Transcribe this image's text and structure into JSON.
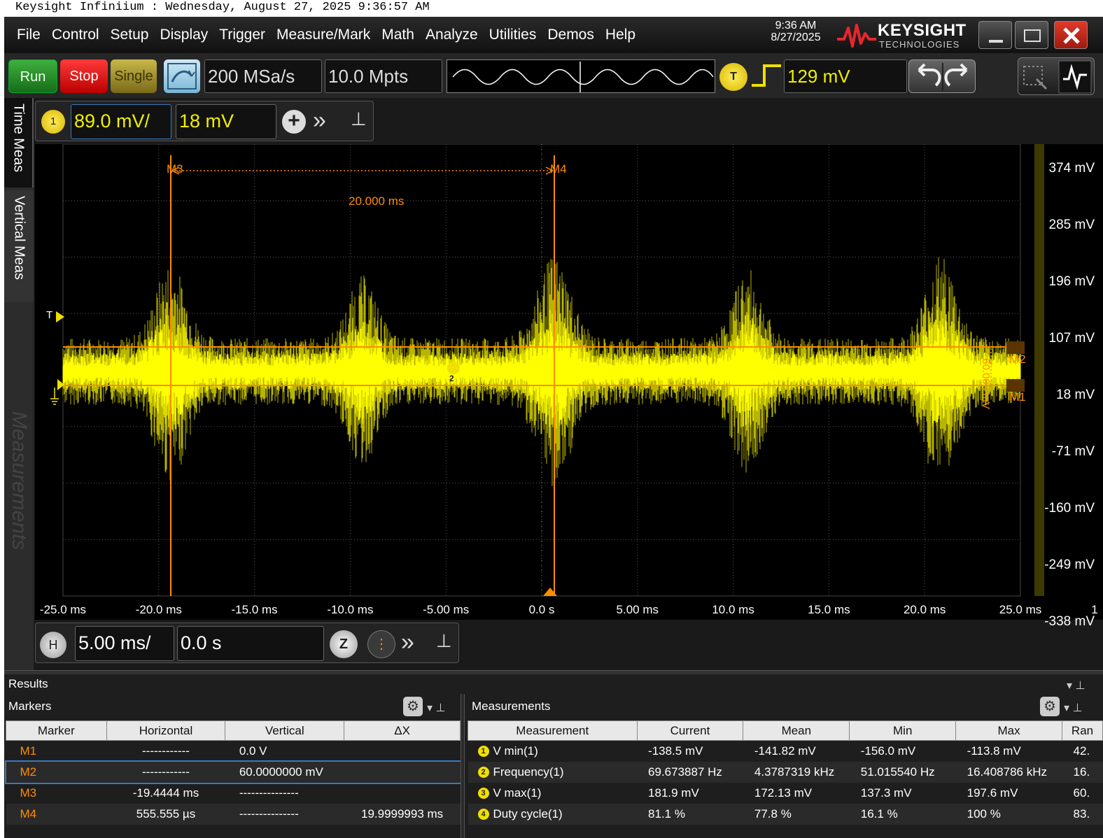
{
  "caption": "Keysight Infiniium : Wednesday, August 27, 2025 9:36:57 AM",
  "menu": [
    "File",
    "Control",
    "Setup",
    "Display",
    "Trigger",
    "Measure/Mark",
    "Math",
    "Analyze",
    "Utilities",
    "Demos",
    "Help"
  ],
  "clock": {
    "time": "9:36 AM",
    "date": "8/27/2025"
  },
  "brand": {
    "name": "KEYSIGHT",
    "sub": "TECHNOLOGIES"
  },
  "toolbar": {
    "run": "Run",
    "stop": "Stop",
    "single": "Single",
    "sample_rate": "200 MSa/s",
    "memory_depth": "10.0 Mpts",
    "trigger_badge": "T",
    "trigger_level": "129 mV"
  },
  "side_tabs": {
    "time_meas": "Time Meas",
    "vertical_meas": "Vertical Meas",
    "measurements": "Measurements"
  },
  "channel": {
    "badge": "1",
    "scale": "89.0 mV/",
    "offset": "18 mV"
  },
  "horizontal": {
    "badge": "H",
    "scale": "5.00 ms/",
    "position": "0.0 s",
    "zoom": "Z"
  },
  "scope": {
    "y_labels": [
      "374 mV",
      "285 mV",
      "196 mV",
      "107 mV",
      "18 mV",
      "-71 mV",
      "-160 mV",
      "-249 mV",
      "-338 mV"
    ],
    "x_labels": [
      "-25.0 ms",
      "-20.0 ms",
      "-15.0 ms",
      "-10.0 ms",
      "-5.00 ms",
      "0.0 s",
      "5.00 ms",
      "10.0 ms",
      "15.0 ms",
      "20.0 ms",
      "25.0 ms"
    ],
    "x_extra": "1",
    "markers": {
      "m1": "M1",
      "m2": "M2",
      "m3": "M3",
      "m4": "M4"
    },
    "delta_x": "20.000 ms",
    "delta_y": "60.000 mV",
    "trigger_marker": "T",
    "meas_marker": "2",
    "colors": {
      "trace": "#ffff00",
      "marker": "#ff8c00",
      "grid": "#555555"
    }
  },
  "results": {
    "title": "Results",
    "markers_title": "Markers",
    "measurements_title": "Measurements",
    "marker_headers": [
      "Marker",
      "Horizontal",
      "Vertical",
      "ΔX"
    ],
    "marker_rows": [
      {
        "name": "M1",
        "horizontal": "------------",
        "vertical": "0.0 V",
        "dx": ""
      },
      {
        "name": "M2",
        "horizontal": "------------",
        "vertical": "60.0000000 mV",
        "dx": ""
      },
      {
        "name": "M3",
        "horizontal": "-19.4444 ms",
        "vertical": "---------------",
        "dx": ""
      },
      {
        "name": "M4",
        "horizontal": "555.555 µs",
        "vertical": "---------------",
        "dx": "19.9999993 ms"
      }
    ],
    "meas_headers": [
      "Measurement",
      "Current",
      "Mean",
      "Min",
      "Max",
      "Ran"
    ],
    "meas_rows": [
      {
        "num": "1",
        "name": "V min(1)",
        "current": "-138.5 mV",
        "mean": "-141.82 mV",
        "min": "-156.0 mV",
        "max": "-113.8 mV",
        "range": "42."
      },
      {
        "num": "2",
        "name": "Frequency(1)",
        "current": "69.673887 Hz",
        "mean": "4.3787319 kHz",
        "min": "51.015540 Hz",
        "max": "16.408786 kHz",
        "range": "16."
      },
      {
        "num": "3",
        "name": "V max(1)",
        "current": "181.9 mV",
        "mean": "172.13 mV",
        "min": "137.3 mV",
        "max": "197.6 mV",
        "range": "60."
      },
      {
        "num": "4",
        "name": "Duty cycle(1)",
        "current": "81.1 %",
        "mean": "77.8 %",
        "min": "16.1 %",
        "max": "100 %",
        "range": "83."
      }
    ]
  }
}
